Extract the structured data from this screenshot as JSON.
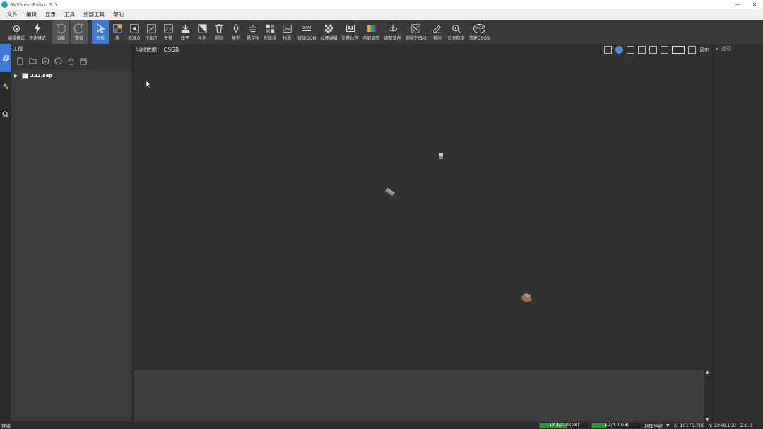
{
  "titlebar": {
    "title": "SVSMeshEditor 3.0",
    "minimize": "—",
    "close": "✕"
  },
  "menu": [
    "文件",
    "编辑",
    "显示",
    "工具",
    "外部工具",
    "帮助"
  ],
  "toolbar": [
    {
      "label": "编辑模式",
      "icon": "edit-mode-icon"
    },
    {
      "label": "快速模式",
      "icon": "lightning-icon"
    },
    {
      "label": "回撤",
      "icon": "undo-icon"
    },
    {
      "label": "重做",
      "icon": "redo-icon"
    },
    {
      "label": "选择",
      "icon": "select-arrow-icon"
    },
    {
      "label": "块",
      "icon": "block-icon"
    },
    {
      "label": "基准点",
      "icon": "reference-point-icon"
    },
    {
      "label": "作业区",
      "icon": "work-area-icon"
    },
    {
      "label": "矢量",
      "icon": "vector-icon"
    },
    {
      "label": "压平",
      "icon": "flatten-icon"
    },
    {
      "label": "补洞",
      "icon": "fill-hole-icon"
    },
    {
      "label": "删除",
      "icon": "trash-icon"
    },
    {
      "label": "模型",
      "icon": "model-icon"
    },
    {
      "label": "悬浮物",
      "icon": "floating-object-icon"
    },
    {
      "label": "新增块",
      "icon": "add-block-icon"
    },
    {
      "label": "材质",
      "icon": "material-icon"
    },
    {
      "label": "挑战DOM",
      "icon": "dom-icon"
    },
    {
      "label": "纹理编辑",
      "icon": "texture-edit-icon"
    },
    {
      "label": "智能纹理",
      "icon": "ai-texture-icon"
    },
    {
      "label": "色彩调整",
      "icon": "color-adjust-icon"
    },
    {
      "label": "调整法向",
      "icon": "adjust-normal-icon"
    },
    {
      "label": "删除空白块",
      "icon": "delete-empty-block-icon"
    },
    {
      "label": "量测",
      "icon": "measure-icon"
    },
    {
      "label": "检查精度",
      "icon": "check-precision-icon"
    },
    {
      "label": "重建OSGB",
      "icon": "rebuild-osgb-icon"
    }
  ],
  "icon_text": {
    "dom": "DOM",
    "ai": "AI",
    "osgb": "OSGB"
  },
  "project": {
    "title": "工程",
    "tree": [
      {
        "label": "222.sep",
        "checked": true
      }
    ]
  },
  "viewport": {
    "current_label": "当前数据：",
    "current_value": "OSGB",
    "show_label": "显示"
  },
  "right_panel": {
    "title": "选项"
  },
  "status": {
    "text": "就绪",
    "mem1": "17.4/31.9(GB)",
    "mem1_fraction": 0.55,
    "mem2": "1.2/4.0(GB)",
    "mem2_fraction": 0.3,
    "coord_system": "地理坐标",
    "x": "X: 10175.705",
    "y": "Y: 2248.168",
    "z": "Z:0.0"
  },
  "colors": {
    "accent": "#3e7ad6",
    "memory_fill": "#1a9e3a"
  }
}
